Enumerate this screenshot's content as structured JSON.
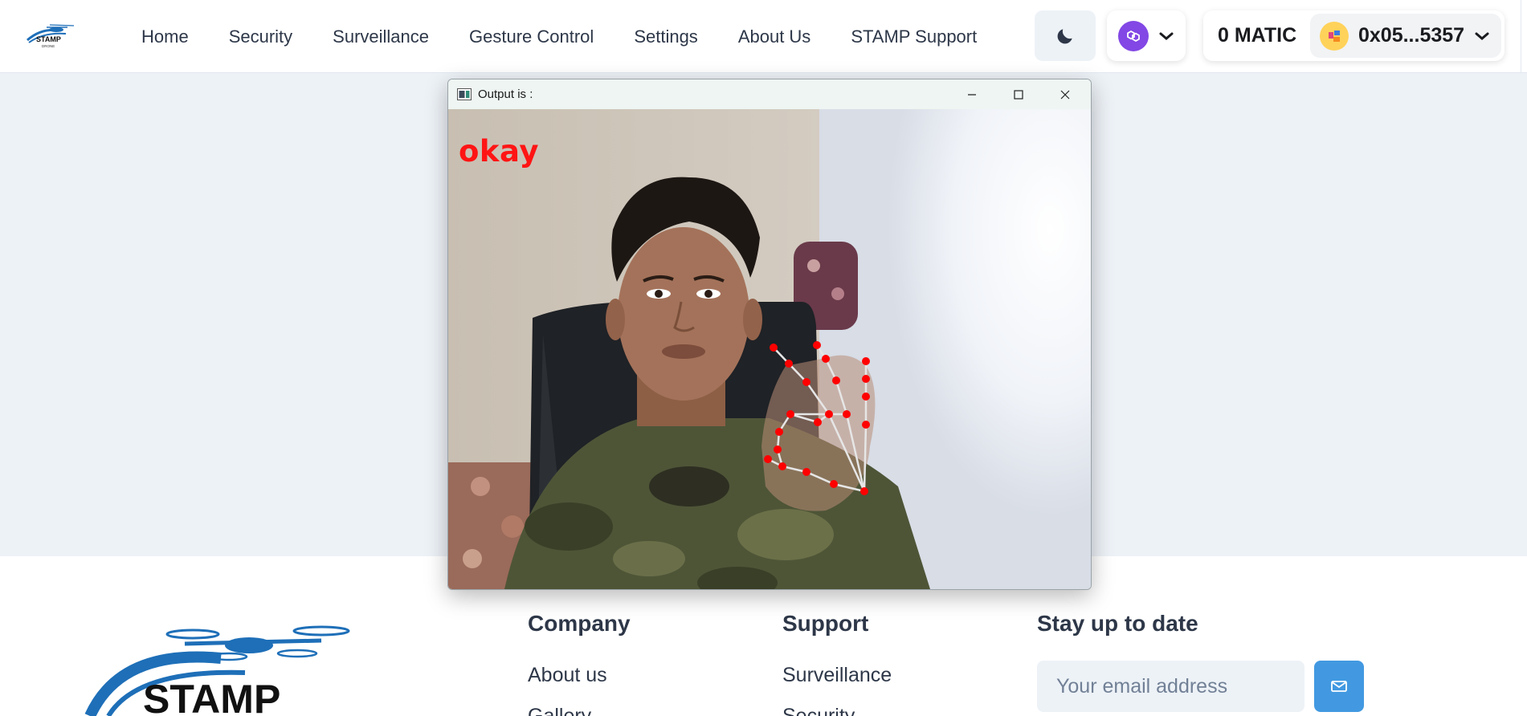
{
  "header": {
    "logo_text": "STAMP DRONE",
    "nav": [
      "Home",
      "Security",
      "Surveillance",
      "Gesture Control",
      "Settings",
      "About Us",
      "STAMP Support"
    ],
    "theme_icon": "moon-icon",
    "chain_icon": "polygon-icon",
    "balance": "0 MATIC",
    "address": "0x05...5357"
  },
  "cv_window": {
    "title": "Output is :",
    "gesture": "okay",
    "controls": [
      "minimize-icon",
      "maximize-icon",
      "close-icon"
    ]
  },
  "footer": {
    "logo_text": "STAMP",
    "company": {
      "heading": "Company",
      "links": [
        "About us",
        "Gallery"
      ]
    },
    "support": {
      "heading": "Support",
      "links": [
        "Surveillance",
        "Security"
      ]
    },
    "newsletter": {
      "heading": "Stay up to date",
      "placeholder": "Your email address",
      "icon": "send-mail-icon"
    }
  },
  "colors": {
    "accent": "#4299e1",
    "page_bg": "#edf2f7",
    "polygon": "#8247e5",
    "gesture_text": "#ff1414",
    "landmark": "#ff0000"
  }
}
